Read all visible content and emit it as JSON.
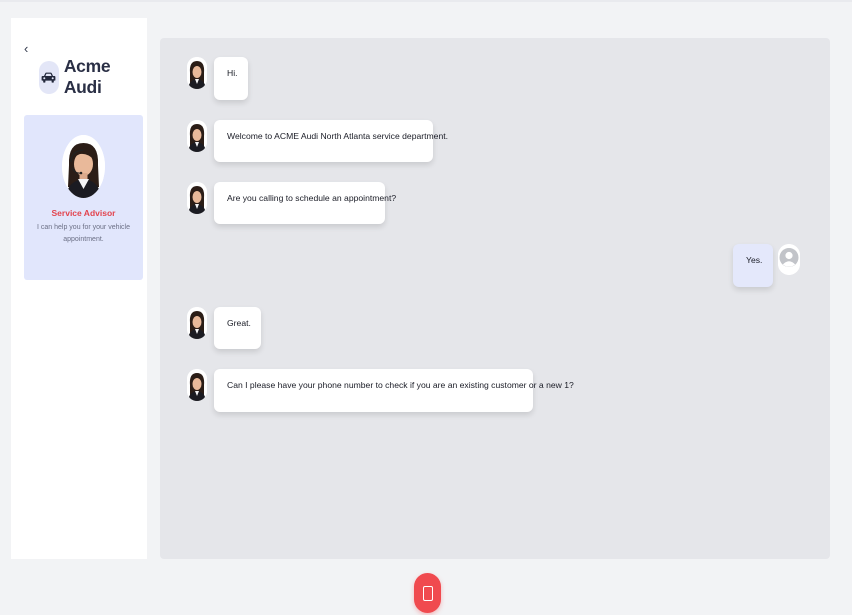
{
  "sidebar": {
    "back_glyph": "‹",
    "brand": {
      "name": "Acme Audi",
      "icon": "car-icon"
    },
    "agent": {
      "role": "Service Advisor",
      "description": "I can help you for your vehicle appointment."
    }
  },
  "chat": {
    "messages": [
      {
        "sender": "agent",
        "text": "Hi."
      },
      {
        "sender": "agent",
        "text": "Welcome to ACME Audi North Atlanta service department."
      },
      {
        "sender": "agent",
        "text": "Are you calling to schedule an appointment?"
      },
      {
        "sender": "user",
        "text": "Yes."
      },
      {
        "sender": "agent",
        "text": "Great."
      },
      {
        "sender": "agent",
        "text": "Can I please have your phone number to check if you are an existing customer or a new 1?"
      }
    ]
  },
  "controls": {
    "end_call_icon": "phone-icon"
  },
  "colors": {
    "accent_red": "#f04a4f",
    "role_red": "#e2434d",
    "agent_card_bg": "#e1e6fc",
    "user_bubble_bg": "#e4e8fb",
    "chat_bg": "#e5e6ea"
  }
}
